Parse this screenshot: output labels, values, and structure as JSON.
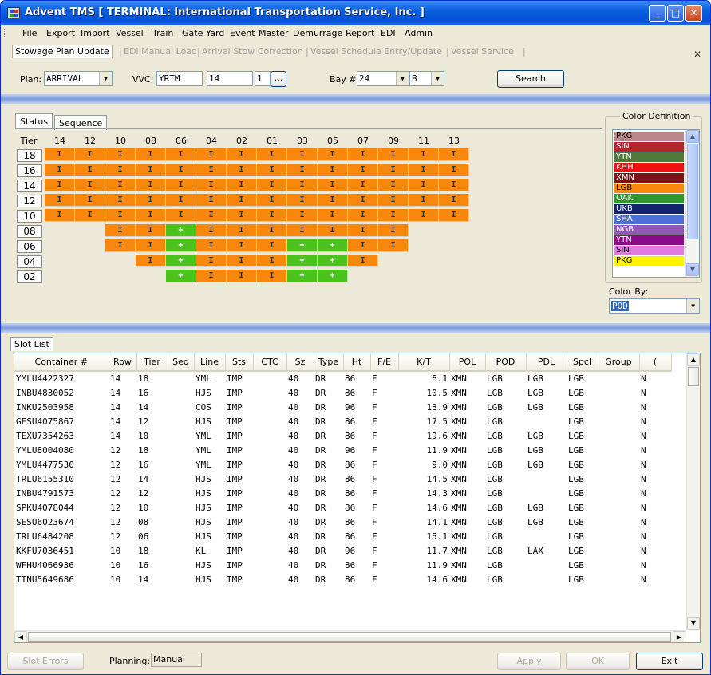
{
  "window": {
    "title": "Advent TMS [ TERMINAL: International Transportation Service, Inc. ]"
  },
  "menu": [
    "File",
    "Export",
    "Import",
    "Vessel",
    "Train",
    "Gate",
    "Yard",
    "Event",
    "Master",
    "Demurrage",
    "Report",
    "EDI",
    "Admin"
  ],
  "tabs": [
    {
      "label": "Stowage Plan Update",
      "active": true
    },
    {
      "label": "EDI Manual Load",
      "active": false
    },
    {
      "label": "Arrival Stow Correction",
      "active": false
    },
    {
      "label": "Vessel Schedule Entry/Update",
      "active": false
    },
    {
      "label": "Vessel Service",
      "active": false
    }
  ],
  "filters": {
    "plan_label": "Plan:",
    "plan_value": "ARRIVAL",
    "vvc_label": "VVC:",
    "vvc_vessel": "YRTM",
    "vvc_voyage": "14",
    "vvc_call": "1",
    "vvc_more": "...",
    "bay_label": "Bay #:",
    "bay_value": "24",
    "bay_side": "B",
    "search_label": "Search"
  },
  "grid": {
    "tab_status": "Status",
    "tab_sequence": "Sequence",
    "tier_header": "Tier",
    "rows_header": [
      "14",
      "12",
      "10",
      "08",
      "06",
      "04",
      "02",
      "01",
      "03",
      "05",
      "07",
      "09",
      "11",
      "13"
    ],
    "tiers": [
      "18",
      "16",
      "14",
      "12",
      "10",
      "08",
      "06",
      "04",
      "02"
    ],
    "cells": [
      [
        "I",
        "I",
        "I",
        "I",
        "I",
        "I",
        "I",
        "I",
        "I",
        "I",
        "I",
        "I",
        "I",
        "I"
      ],
      [
        "I",
        "I",
        "I",
        "I",
        "I",
        "I",
        "I",
        "I",
        "I",
        "I",
        "I",
        "I",
        "I",
        "I"
      ],
      [
        "I",
        "I",
        "I",
        "I",
        "I",
        "I",
        "I",
        "I",
        "I",
        "I",
        "I",
        "I",
        "I",
        "I"
      ],
      [
        "I",
        "I",
        "I",
        "I",
        "I",
        "I",
        "I",
        "I",
        "I",
        "I",
        "I",
        "I",
        "I",
        "I"
      ],
      [
        "I",
        "I",
        "I",
        "I",
        "I",
        "I",
        "I",
        "I",
        "I",
        "I",
        "I",
        "I",
        "I",
        "I"
      ],
      [
        "",
        "",
        "I",
        "I",
        "+",
        "I",
        "I",
        "I",
        "I",
        "I",
        "I",
        "I",
        "",
        ""
      ],
      [
        "",
        "",
        "I",
        "I",
        "+",
        "I",
        "I",
        "I",
        "+",
        "+",
        "I",
        "I",
        "",
        ""
      ],
      [
        "",
        "",
        "",
        "I",
        "+",
        "I",
        "I",
        "I",
        "+",
        "+",
        "I",
        "",
        "",
        ""
      ],
      [
        "",
        "",
        "",
        "",
        "+",
        "I",
        "I",
        "I",
        "+",
        "+",
        "",
        "",
        "",
        ""
      ]
    ],
    "colors": {
      "I": "#f7870d",
      "+": "#4bc31c"
    }
  },
  "color_definition": {
    "legend": "Color Definition",
    "items": [
      {
        "label": "PKG",
        "color": "#b9878a",
        "text": "#000"
      },
      {
        "label": "SIN",
        "color": "#b0262c",
        "text": "#fff"
      },
      {
        "label": "YTN",
        "color": "#4f7a3a",
        "text": "#fff"
      },
      {
        "label": "KHH",
        "color": "#ee1111",
        "text": "#fff"
      },
      {
        "label": "XMN",
        "color": "#7a1414",
        "text": "#fff"
      },
      {
        "label": "LGB",
        "color": "#f7870d",
        "text": "#000"
      },
      {
        "label": "OAK",
        "color": "#2e9a2e",
        "text": "#fff"
      },
      {
        "label": "UKB",
        "color": "#12236e",
        "text": "#fff"
      },
      {
        "label": "SHA",
        "color": "#4f6fd8",
        "text": "#fff"
      },
      {
        "label": "NGB",
        "color": "#9058b0",
        "text": "#fff"
      },
      {
        "label": "YTN",
        "color": "#8a0a8a",
        "text": "#fff"
      },
      {
        "label": "SIN",
        "color": "#e07be0",
        "text": "#000"
      },
      {
        "label": "PKG",
        "color": "#fff200",
        "text": "#000"
      }
    ],
    "color_by_label": "Color By:",
    "color_by_value": "POD"
  },
  "slot_list": {
    "tab": "Slot List",
    "columns": [
      "Container #",
      "Row",
      "Tier",
      "Seq",
      "Line",
      "Sts",
      "CTC",
      "Sz",
      "Type",
      "Ht",
      "F/E",
      "K/T",
      "POL",
      "POD",
      "PDL",
      "Spcl",
      "Group",
      "("
    ],
    "rows": [
      [
        "YMLU4422327",
        "14",
        "18",
        "",
        "YML",
        "IMP",
        "",
        "40",
        "DR",
        "86",
        "F",
        "6.1",
        "XMN",
        "LGB",
        "LGB",
        "LGB",
        "",
        "N"
      ],
      [
        "INBU4830052",
        "14",
        "16",
        "",
        "HJS",
        "IMP",
        "",
        "40",
        "DR",
        "86",
        "F",
        "10.5",
        "XMN",
        "LGB",
        "LGB",
        "LGB",
        "",
        "N"
      ],
      [
        "INKU2503958",
        "14",
        "14",
        "",
        "COS",
        "IMP",
        "",
        "40",
        "DR",
        "96",
        "F",
        "13.9",
        "XMN",
        "LGB",
        "LGB",
        "LGB",
        "",
        "N"
      ],
      [
        "GESU4075867",
        "14",
        "12",
        "",
        "HJS",
        "IMP",
        "",
        "40",
        "DR",
        "86",
        "F",
        "17.5",
        "XMN",
        "LGB",
        "",
        "LGB",
        "",
        "N"
      ],
      [
        "TEXU7354263",
        "14",
        "10",
        "",
        "YML",
        "IMP",
        "",
        "40",
        "DR",
        "86",
        "F",
        "19.6",
        "XMN",
        "LGB",
        "LGB",
        "LGB",
        "",
        "N"
      ],
      [
        "YMLU8004080",
        "12",
        "18",
        "",
        "YML",
        "IMP",
        "",
        "40",
        "DR",
        "96",
        "F",
        "11.9",
        "XMN",
        "LGB",
        "LGB",
        "LGB",
        "",
        "N"
      ],
      [
        "YMLU4477530",
        "12",
        "16",
        "",
        "YML",
        "IMP",
        "",
        "40",
        "DR",
        "86",
        "F",
        "9.0",
        "XMN",
        "LGB",
        "LGB",
        "LGB",
        "",
        "N"
      ],
      [
        "TRLU6155310",
        "12",
        "14",
        "",
        "HJS",
        "IMP",
        "",
        "40",
        "DR",
        "86",
        "F",
        "14.5",
        "XMN",
        "LGB",
        "",
        "LGB",
        "",
        "N"
      ],
      [
        "INBU4791573",
        "12",
        "12",
        "",
        "HJS",
        "IMP",
        "",
        "40",
        "DR",
        "86",
        "F",
        "14.3",
        "XMN",
        "LGB",
        "",
        "LGB",
        "",
        "N"
      ],
      [
        "SPKU4078044",
        "12",
        "10",
        "",
        "HJS",
        "IMP",
        "",
        "40",
        "DR",
        "86",
        "F",
        "14.6",
        "XMN",
        "LGB",
        "LGB",
        "LGB",
        "",
        "N"
      ],
      [
        "SESU6023674",
        "12",
        "08",
        "",
        "HJS",
        "IMP",
        "",
        "40",
        "DR",
        "86",
        "F",
        "14.1",
        "XMN",
        "LGB",
        "LGB",
        "LGB",
        "",
        "N"
      ],
      [
        "TRLU6484208",
        "12",
        "06",
        "",
        "HJS",
        "IMP",
        "",
        "40",
        "DR",
        "86",
        "F",
        "15.1",
        "XMN",
        "LGB",
        "",
        "LGB",
        "",
        "N"
      ],
      [
        "KKFU7036451",
        "10",
        "18",
        "",
        "KL",
        "IMP",
        "",
        "40",
        "DR",
        "96",
        "F",
        "11.7",
        "XMN",
        "LGB",
        "LAX",
        "LGB",
        "",
        "N"
      ],
      [
        "WFHU4066936",
        "10",
        "16",
        "",
        "HJS",
        "IMP",
        "",
        "40",
        "DR",
        "86",
        "F",
        "11.9",
        "XMN",
        "LGB",
        "",
        "LGB",
        "",
        "N"
      ],
      [
        "TTNU5649686",
        "10",
        "14",
        "",
        "HJS",
        "IMP",
        "",
        "40",
        "DR",
        "86",
        "F",
        "14.6",
        "XMN",
        "LGB",
        "",
        "LGB",
        "",
        "N"
      ]
    ]
  },
  "footer": {
    "slot_errors": "Slot Errors",
    "planning_label": "Planning:",
    "planning_value": "Manual",
    "apply": "Apply",
    "ok": "OK",
    "exit": "Exit"
  }
}
